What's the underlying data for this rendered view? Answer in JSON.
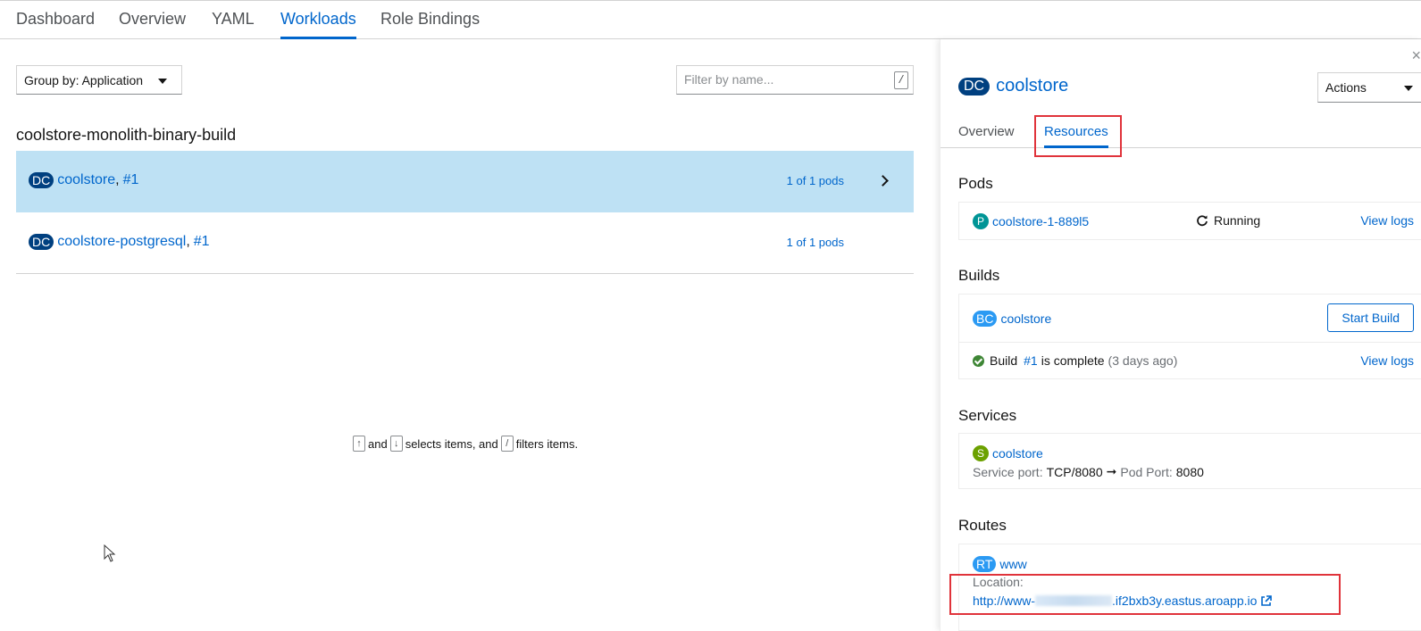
{
  "top_tabs": [
    "Dashboard",
    "Overview",
    "YAML",
    "Workloads",
    "Role Bindings"
  ],
  "active_top_tab": "Workloads",
  "group_by": "Group by: Application",
  "filter": {
    "placeholder": "Filter by name...",
    "value": "",
    "shortcut": "/"
  },
  "group_title": "coolstore-monolith-binary-build",
  "workloads": [
    {
      "badge": "DC",
      "name": "coolstore",
      "sep": ",",
      "revision": "#1",
      "pods": "1 of 1 pods",
      "selected": true
    },
    {
      "badge": "DC",
      "name": "coolstore-postgresql",
      "sep": ",",
      "revision": "#1",
      "pods": "1 of 1 pods",
      "selected": false
    }
  ],
  "hint": {
    "up": "↑",
    "and": "and",
    "down": "↓",
    "selects": "selects items, and",
    "slash": "/",
    "filters": "filters items."
  },
  "side": {
    "close": "×",
    "badge": "DC",
    "title": "coolstore",
    "actions": "Actions",
    "tabs": [
      "Overview",
      "Resources"
    ],
    "active_tab": "Resources",
    "pods": {
      "title": "Pods",
      "badge": "P",
      "name": "coolstore-1-889l5",
      "status": "Running",
      "view_logs": "View logs"
    },
    "builds": {
      "title": "Builds",
      "badge": "BC",
      "name": "coolstore",
      "start_build": "Start Build",
      "build_label": "Build",
      "build_number": "#1",
      "build_status": "is complete",
      "build_age": "(3 days ago)",
      "view_logs": "View logs"
    },
    "services": {
      "title": "Services",
      "badge": "S",
      "name": "coolstore",
      "service_port_label": "Service port:",
      "service_port": "TCP/8080",
      "arrow": "➞",
      "pod_port_label": "Pod Port:",
      "pod_port": "8080"
    },
    "routes": {
      "title": "Routes",
      "badge": "RT",
      "name": "www",
      "location_label": "Location:",
      "url_prefix": "http://www-",
      "url_suffix": ".if2bxb3y.eastus.aroapp.io"
    }
  },
  "colors": {
    "accent": "#0066cc",
    "selected_row": "#bee1f4",
    "highlight_box": "#e0333b",
    "dc_badge": "#004080"
  }
}
